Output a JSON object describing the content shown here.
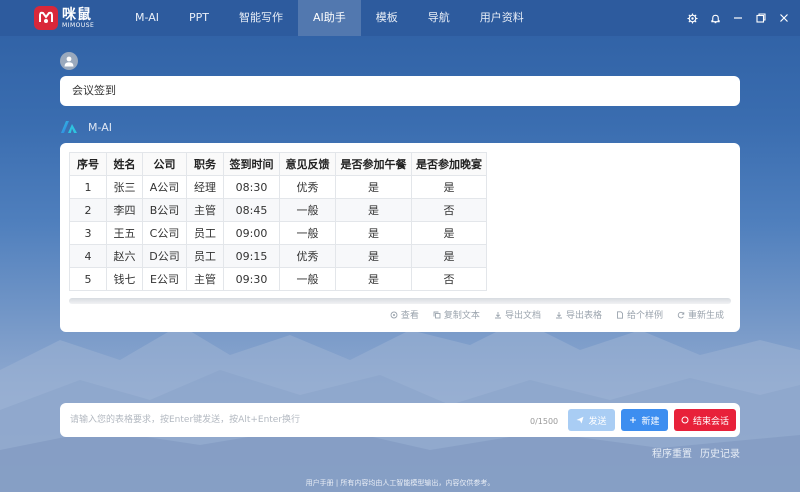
{
  "app": {
    "logo_cn": "咪鼠",
    "logo_en": "MIMOUSE",
    "brand_color": "#d9283a"
  },
  "nav": {
    "items": [
      {
        "label": "M-AI"
      },
      {
        "label": "PPT"
      },
      {
        "label": "智能写作"
      },
      {
        "label": "AI助手",
        "active": true
      },
      {
        "label": "模板"
      },
      {
        "label": "导航"
      },
      {
        "label": "用户资料"
      }
    ]
  },
  "window_controls": [
    "gear-icon",
    "bell-icon",
    "minimize-icon",
    "restore-icon",
    "close-icon"
  ],
  "chat": {
    "user_query": "会议签到",
    "ai_name": "M-AI"
  },
  "table": {
    "headers": [
      "序号",
      "姓名",
      "公司",
      "职务",
      "签到时间",
      "意见反馈",
      "是否参加午餐",
      "是否参加晚宴"
    ],
    "rows": [
      [
        "1",
        "张三",
        "A公司",
        "经理",
        "08:30",
        "优秀",
        "是",
        "是"
      ],
      [
        "2",
        "李四",
        "B公司",
        "主管",
        "08:45",
        "一般",
        "是",
        "否"
      ],
      [
        "3",
        "王五",
        "C公司",
        "员工",
        "09:00",
        "一般",
        "是",
        "是"
      ],
      [
        "4",
        "赵六",
        "D公司",
        "员工",
        "09:15",
        "优秀",
        "是",
        "是"
      ],
      [
        "5",
        "钱七",
        "E公司",
        "主管",
        "09:30",
        "一般",
        "是",
        "否"
      ]
    ]
  },
  "answer_actions": [
    {
      "label": "查看",
      "icon": "view-icon"
    },
    {
      "label": "复制文本",
      "icon": "copy-icon"
    },
    {
      "label": "导出文档",
      "icon": "download-icon"
    },
    {
      "label": "导出表格",
      "icon": "download-icon"
    },
    {
      "label": "给个样例",
      "icon": "file-icon"
    },
    {
      "label": "重新生成",
      "icon": "refresh-icon"
    }
  ],
  "input": {
    "placeholder": "请输入您的表格要求，按Enter键发送，按Alt+Enter换行",
    "counter": "0/1500",
    "send_label": "发送",
    "new_label": "新建",
    "end_label": "结束会话"
  },
  "links": {
    "reset": "程序重置",
    "history": "历史记录"
  },
  "footer": "用户手册 | 所有内容均由人工智能模型输出，内容仅供参考。"
}
